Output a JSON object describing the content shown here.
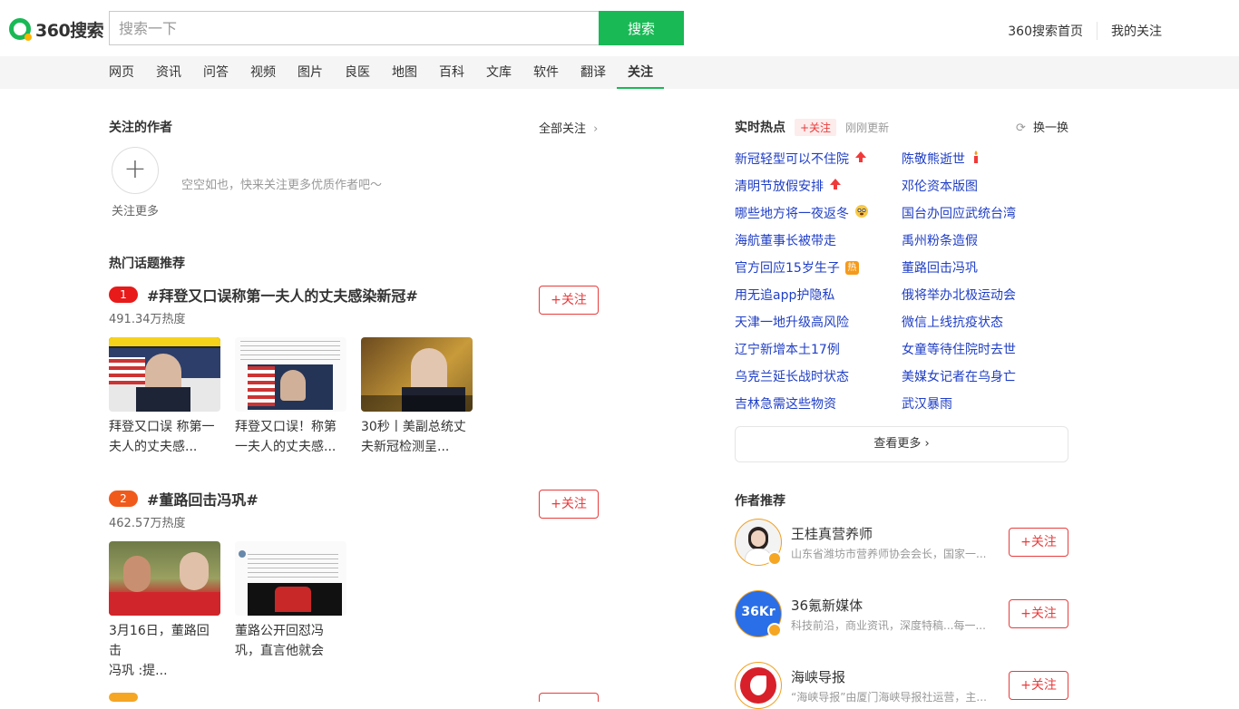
{
  "header": {
    "logo_text": "360搜索",
    "search_placeholder": "搜索一下",
    "search_button": "搜索",
    "links": [
      "360搜索首页",
      "我的关注"
    ]
  },
  "nav": {
    "items": [
      "网页",
      "资讯",
      "问答",
      "视频",
      "图片",
      "良医",
      "地图",
      "百科",
      "文库",
      "软件",
      "翻译",
      "关注"
    ],
    "active": "关注"
  },
  "followed_authors": {
    "title": "关注的作者",
    "all_follow": "全部关注",
    "follow_more": "关注更多",
    "empty_text": "空空如也，快来关注更多优质作者吧～"
  },
  "hot_topics": {
    "title": "热门话题推荐",
    "follow_label": "+关注",
    "topics": [
      {
        "rank": "1",
        "rank_color": "#e81a1a",
        "name": "#拜登又口误称第一夫人的丈夫感染新冠#",
        "heat": "491.34万热度",
        "cards": [
          {
            "title_l1": "拜登又口误 称第一",
            "title_l2": "夫人的丈夫感..."
          },
          {
            "title_l1": "拜登又口误！称第",
            "title_l2": "一夫人的丈夫感..."
          },
          {
            "title_l1": "30秒丨美副总统丈",
            "title_l2": "夫新冠检测呈..."
          }
        ]
      },
      {
        "rank": "2",
        "rank_color": "#f05a1a",
        "name": "#董路回击冯巩#",
        "heat": "462.57万热度",
        "cards": [
          {
            "title_l1": "3月16日，董路回击",
            "title_l2": "冯巩 :提..."
          },
          {
            "title_l1": "董路公开回怼冯",
            "title_l2": "巩，直言他就会"
          }
        ]
      }
    ]
  },
  "realtime": {
    "title": "实时热点",
    "follow_tag": "+关注",
    "updated": "刚刚更新",
    "refresh": "换一换",
    "left": [
      {
        "text": "新冠轻型可以不住院",
        "badge": "up-arrow-icon"
      },
      {
        "text": "清明节放假安排",
        "badge": "up-arrow-icon"
      },
      {
        "text": "哪些地方将一夜返冬",
        "badge": "emoji-icon"
      },
      {
        "text": "海航董事长被带走",
        "badge": ""
      },
      {
        "text": "官方回应15岁生子",
        "badge": "hot-icon"
      },
      {
        "text": "用无追app护隐私",
        "badge": ""
      },
      {
        "text": "天津一地升级高风险",
        "badge": ""
      },
      {
        "text": "辽宁新增本土17例",
        "badge": ""
      },
      {
        "text": "乌克兰延长战时状态",
        "badge": ""
      },
      {
        "text": "吉林急需这些物资",
        "badge": ""
      }
    ],
    "right": [
      {
        "text": "陈敬熊逝世",
        "badge": "candle-icon"
      },
      {
        "text": "邓伦资本版图",
        "badge": ""
      },
      {
        "text": "国台办回应武统台湾",
        "badge": ""
      },
      {
        "text": "禹州粉条造假",
        "badge": ""
      },
      {
        "text": "董路回击冯巩",
        "badge": ""
      },
      {
        "text": "俄将举办北极运动会",
        "badge": ""
      },
      {
        "text": "微信上线抗疫状态",
        "badge": ""
      },
      {
        "text": "女童等待住院时去世",
        "badge": ""
      },
      {
        "text": "美媒女记者在乌身亡",
        "badge": ""
      },
      {
        "text": "武汉暴雨",
        "badge": ""
      }
    ],
    "hot_badge_text": "热",
    "more": "查看更多"
  },
  "author_rec": {
    "title": "作者推荐",
    "follow_label": "+关注",
    "authors": [
      {
        "name": "王桂真营养师",
        "desc": "山东省潍坊市营养师协会会长，国家一..."
      },
      {
        "name": "36氪新媒体",
        "desc": "科技前沿，商业资讯，深度特稿...每一..."
      },
      {
        "name": "海峡导报",
        "desc": "“海峡导报”由厦门海峡导报社运营，主..."
      }
    ],
    "kr_logo_text": "36Kr"
  }
}
